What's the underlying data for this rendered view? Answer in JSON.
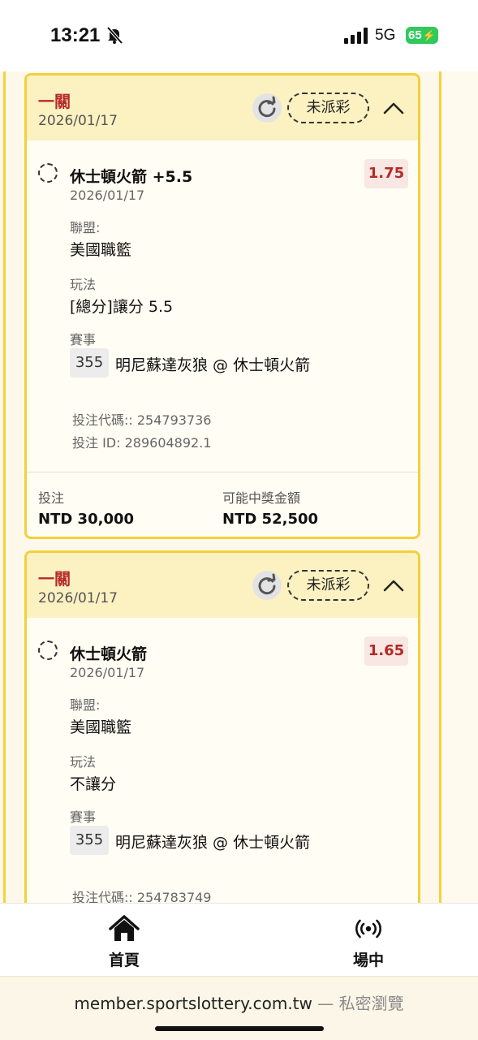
{
  "status_bar": {
    "time": "13:21",
    "network": "5G",
    "battery": "65"
  },
  "bets": [
    {
      "type": "一關",
      "date": "2026/01/17",
      "status": "未派彩",
      "selection": "休士頓火箭 +5.5",
      "selection_date": "2026/01/17",
      "odds": "1.75",
      "league_label": "聯盟:",
      "league": "美國職籃",
      "play_label": "玩法",
      "play": "[總分]讓分 5.5",
      "event_label": "賽事",
      "match_no": "355",
      "match": "明尼蘇達灰狼 @ 休士頓火箭",
      "bet_code": "投注代碼:: 254793736",
      "bet_id": "投注 ID: 289604892.1",
      "stake_label": "投注",
      "stake": "NTD 30,000",
      "payout_label": "可能中獎金額",
      "payout": "NTD 52,500"
    },
    {
      "type": "一關",
      "date": "2026/01/17",
      "status": "未派彩",
      "selection": "休士頓火箭",
      "selection_date": "2026/01/17",
      "odds": "1.65",
      "league_label": "聯盟:",
      "league": "美國職籃",
      "play_label": "玩法",
      "play": "不讓分",
      "event_label": "賽事",
      "match_no": "355",
      "match": "明尼蘇達灰狼 @ 休士頓火箭",
      "bet_code": "投注代碼:: 254783749"
    }
  ],
  "nav": {
    "home": "首頁",
    "live": "場中"
  },
  "browser": {
    "url": "member.sportslottery.com.tw",
    "separator": "—",
    "mode": "私密瀏覽"
  }
}
